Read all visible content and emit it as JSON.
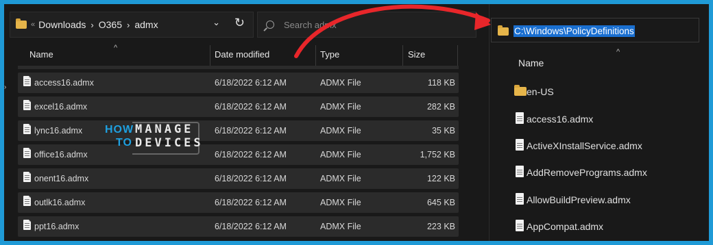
{
  "left_explorer": {
    "breadcrumbs": [
      "Downloads",
      "O365",
      "admx"
    ],
    "search_placeholder": "Search admx",
    "columns": {
      "name": "Name",
      "date": "Date modified",
      "type": "Type",
      "size": "Size"
    },
    "rows": [
      {
        "name": "access16.admx",
        "date": "6/18/2022 6:12 AM",
        "type": "ADMX File",
        "size": "118 KB"
      },
      {
        "name": "excel16.admx",
        "date": "6/18/2022 6:12 AM",
        "type": "ADMX File",
        "size": "282 KB"
      },
      {
        "name": "lync16.admx",
        "date": "6/18/2022 6:12 AM",
        "type": "ADMX File",
        "size": "35 KB"
      },
      {
        "name": "office16.admx",
        "date": "6/18/2022 6:12 AM",
        "type": "ADMX File",
        "size": "1,752 KB"
      },
      {
        "name": "onent16.admx",
        "date": "6/18/2022 6:12 AM",
        "type": "ADMX File",
        "size": "122 KB"
      },
      {
        "name": "outlk16.admx",
        "date": "6/18/2022 6:12 AM",
        "type": "ADMX File",
        "size": "645 KB"
      },
      {
        "name": "ppt16.admx",
        "date": "6/18/2022 6:12 AM",
        "type": "ADMX File",
        "size": "223 KB"
      }
    ]
  },
  "watermark": {
    "how": "HOW",
    "to": "TO",
    "manage": "MANAGE",
    "devices": "DEVICES"
  },
  "right_explorer": {
    "path": "C:\\Windows\\PolicyDefinitions",
    "column_name": "Name",
    "items": [
      {
        "name": "en-US",
        "kind": "folder"
      },
      {
        "name": "access16.admx",
        "kind": "file"
      },
      {
        "name": "ActiveXInstallService.admx",
        "kind": "file"
      },
      {
        "name": "AddRemovePrograms.admx",
        "kind": "file"
      },
      {
        "name": "AllowBuildPreview.admx",
        "kind": "file"
      },
      {
        "name": "AppCompat.admx",
        "kind": "file"
      }
    ]
  },
  "colors": {
    "frame": "#1f9ad6",
    "arrow": "#e8262a",
    "selection": "#1a6fd0"
  }
}
